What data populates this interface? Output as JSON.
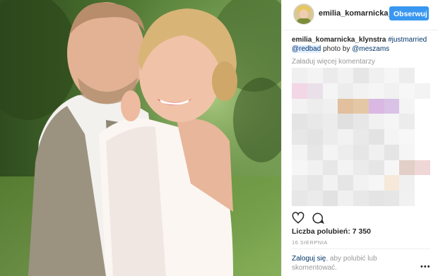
{
  "post": {
    "username": "emilia_komarnicka_",
    "follow_label": "Obserwuj"
  },
  "caption": {
    "user": "emilia_komarnicka_klynstra",
    "hashtag": "#justmarried",
    "mention_tag": "@redbad",
    "photo_by": "photo by",
    "credit": "@meszams"
  },
  "load_more_label": "Załaduj więcej komentarzy",
  "likes_text": "Liczba polubień: 7 350",
  "date_text": "16 SIERPNIA",
  "login": {
    "link": "Zaloguj się",
    "rest": ", aby polubić lub skomentować."
  },
  "more_label": "•••",
  "icons": [
    "heart-icon",
    "comment-icon",
    "more-options-icon"
  ],
  "colors": {
    "follow_button": "#3897f0",
    "link": "#003569"
  },
  "pixelated_colors": [
    "#f0f0f0",
    "#f4f4f4",
    "#ebebeb",
    "#f2f2f2",
    "#e6e6e6",
    "#f0f0f0",
    "#f6f6f6",
    "#ededed",
    "#ffffff",
    "#f3d7e6",
    "#e9e0ea",
    "#f5f5f5",
    "#ececec",
    "#f2f2f2",
    "#f5f5f5",
    "#f1f1f1",
    "#f7f7f7",
    "#f3f3f3",
    "#f2f2f2",
    "#ededed",
    "#f0f0f0",
    "#e2c09e",
    "#e4c8a6",
    "#d9b8e3",
    "#d9c2e6",
    "#f4f4f4",
    "#ffffff",
    "#e4e4e4",
    "#e8e8e8",
    "#ececec",
    "#e0e0e0",
    "#e7e7e7",
    "#f1f1f1",
    "#f5f5f5",
    "#ececec",
    "#ffffff",
    "#e7e7e7",
    "#e3e3e3",
    "#ececec",
    "#f2f2f2",
    "#e9e9e9",
    "#e3e3e3",
    "#f4f4f4",
    "#f7f7f7",
    "#ffffff",
    "#f3f3f3",
    "#e6e6e6",
    "#f4f4f4",
    "#ededed",
    "#e6e6e6",
    "#f0f0f0",
    "#e5e5e5",
    "#f5f5f5",
    "#ffffff",
    "#f6f6f6",
    "#f1f1f1",
    "#e7e7e7",
    "#f3f3f3",
    "#ebebeb",
    "#e6e6e6",
    "#f6f6f6",
    "#e2cfc8",
    "#f0d7d7",
    "#ececec",
    "#e6e6e6",
    "#f2f2f2",
    "#e5e5e5",
    "#f2f2f2",
    "#f6f6f6",
    "#f6e9d9",
    "#f0f0f0",
    "#ffffff",
    "#e7e7e7",
    "#ebebeb",
    "#e2e2e2",
    "#f0f0f0",
    "#e8e8e8",
    "#e4e4e4",
    "#e6e6e6",
    "#f1f1f1",
    "#ffffff"
  ]
}
